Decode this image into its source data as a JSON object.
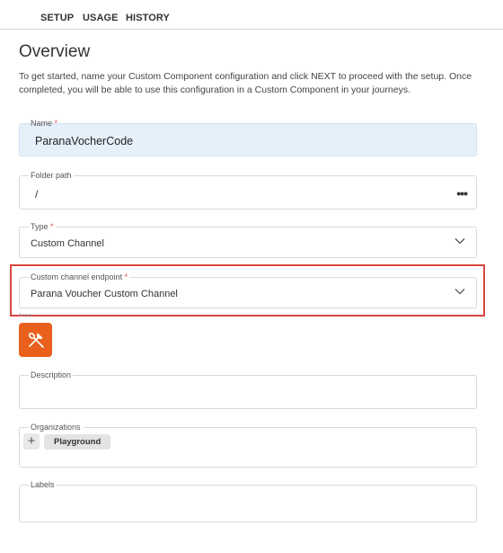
{
  "tabs": [
    {
      "label": "SETUP"
    },
    {
      "label": "USAGE"
    },
    {
      "label": "HISTORY"
    }
  ],
  "page": {
    "title": "Overview",
    "intro": "To get started, name your Custom Component configuration and click NEXT to proceed with the setup. Once completed, you will be able to use this configuration in a Custom Component in your journeys."
  },
  "fields": {
    "name": {
      "label": "Name",
      "required_mark": "*",
      "value": "ParanaVocherCode"
    },
    "folder": {
      "label": "Folder path",
      "value": "/",
      "menu_glyph": "•••"
    },
    "type": {
      "label": "Type",
      "required_mark": "*",
      "value": "Custom Channel"
    },
    "endpoint": {
      "label": "Custom channel endpoint",
      "required_mark": "*",
      "value": "Parana Voucher Custom Channel"
    },
    "icon": {
      "label": "Icon",
      "icon_name": "tools-icon",
      "tile_color": "#e8601c"
    },
    "description": {
      "label": "Description",
      "value": ""
    },
    "organizations": {
      "label": "Organizations",
      "add_glyph": "+",
      "chips": [
        {
          "label": "Playground"
        }
      ]
    },
    "labels": {
      "label": "Labels",
      "value": ""
    }
  },
  "colors": {
    "highlight": "#d9453f",
    "name_field_bg": "#e6f0fb",
    "required": "#d9534f"
  }
}
